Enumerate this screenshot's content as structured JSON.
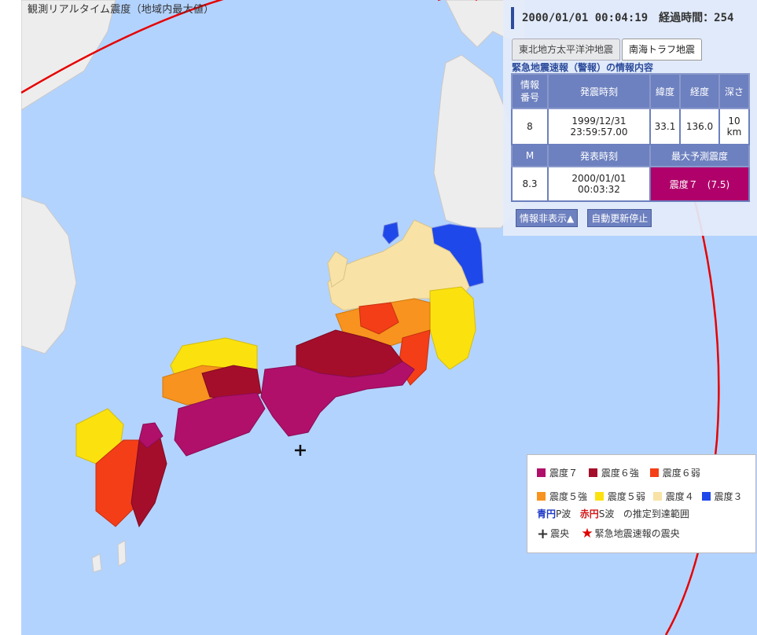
{
  "map": {
    "title": "観測リアルタイム震度（地域内最大値）"
  },
  "panel": {
    "datetime": "2000/01/01 00:04:19",
    "elapsed_label": "経過時間：254",
    "tabs": [
      {
        "label": "東北地方太平洋沖地震",
        "active": false
      },
      {
        "label": "南海トラフ地震",
        "active": true
      }
    ],
    "heading": "緊急地震速報（警報）の情報内容",
    "table": {
      "hdr_num": "情報番号",
      "hdr_time": "発震時刻",
      "hdr_lat": "緯度",
      "hdr_lon": "経度",
      "hdr_depth": "深さ",
      "num": "8",
      "origin_date": "1999/12/31",
      "origin_time": "23:59:57.00",
      "lat": "33.1",
      "lon": "136.0",
      "depth_value": "10",
      "depth_unit": "km",
      "hdr_mag": "M",
      "hdr_issue": "発表時刻",
      "hdr_max": "最大予測震度",
      "mag": "8.3",
      "issue_date": "2000/01/01",
      "issue_time": "00:03:32",
      "max_intensity": "震度７　(7.5)"
    },
    "buttons": {
      "hide": "情報非表示▲",
      "stop": "自動更新停止"
    }
  },
  "legend": {
    "items_row1": [
      {
        "label": "震度７",
        "color": "#b0106a"
      },
      {
        "label": "震度６強",
        "color": "#a50e2a"
      },
      {
        "label": "震度６弱",
        "color": "#f43e18"
      }
    ],
    "items_row2": [
      {
        "label": "震度５強",
        "color": "#f7931e"
      },
      {
        "label": "震度５弱",
        "color": "#fbe20f"
      },
      {
        "label": "震度４",
        "color": "#f9e2a6"
      },
      {
        "label": "震度３",
        "color": "#1f48ea"
      }
    ],
    "p_wave_word": "青円",
    "p_wave_suffix": "P波",
    "s_wave_word": "赤円",
    "s_wave_suffix": "S波",
    "range_text": "の推定到達範囲",
    "epicenter_label": "震央",
    "eew_epicenter_label": "緊急地震速報の震央"
  },
  "colors": {
    "sea": "#b3d3ff",
    "land_other": "#ededed",
    "s_wave_circle": "#e60000",
    "panel_header": "#6d80bf"
  }
}
